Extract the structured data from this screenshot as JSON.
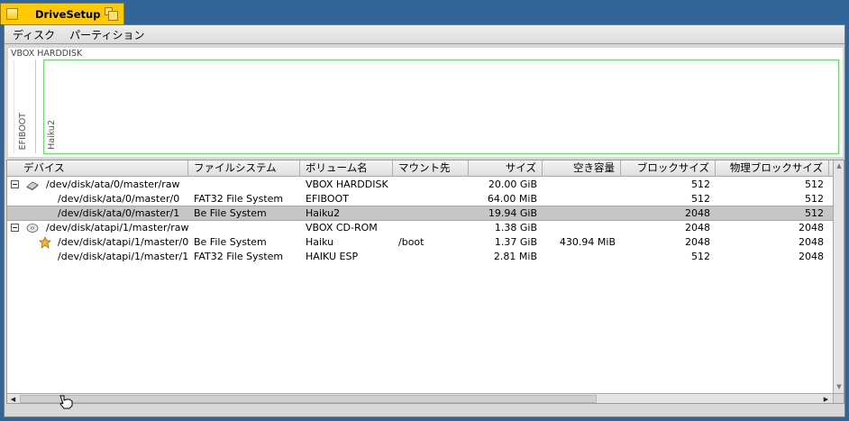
{
  "window": {
    "title": "DriveSetup"
  },
  "menu": {
    "items": [
      "ディスク",
      "パーティション"
    ]
  },
  "disk_map": {
    "disk_label": "VBOX HARDDISK",
    "partitions": [
      "EFIBOOT",
      "Haiku2"
    ]
  },
  "table": {
    "columns": [
      "デバイス",
      "ファイルシステム",
      "ボリューム名",
      "マウント先",
      "サイズ",
      "空き容量",
      "ブロックサイズ",
      "物理ブロックサイズ"
    ],
    "rows": [
      {
        "device": "/dev/disk/ata/0/master/raw",
        "fs": "",
        "volume": "VBOX HARDDISK",
        "mount": "",
        "size": "20.00 GiB",
        "free": "",
        "block": "512",
        "phys": "512",
        "icon": "hard-disk-icon",
        "expander": true
      },
      {
        "device": "/dev/disk/ata/0/master/0",
        "fs": "FAT32 File System",
        "volume": "EFIBOOT",
        "mount": "",
        "size": "64.00 MiB",
        "free": "",
        "block": "512",
        "phys": "512"
      },
      {
        "device": "/dev/disk/ata/0/master/1",
        "fs": "Be File System",
        "volume": "Haiku2",
        "mount": "",
        "size": "19.94 GiB",
        "free": "",
        "block": "2048",
        "phys": "512",
        "selected": true
      },
      {
        "device": "/dev/disk/atapi/1/master/raw",
        "fs": "",
        "volume": "VBOX CD-ROM",
        "mount": "",
        "size": "1.38 GiB",
        "free": "",
        "block": "2048",
        "phys": "2048",
        "icon": "cd-rom-icon",
        "expander": true
      },
      {
        "device": "/dev/disk/atapi/1/master/0",
        "fs": "Be File System",
        "volume": "Haiku",
        "mount": "/boot",
        "size": "1.37 GiB",
        "free": "430.94 MiB",
        "block": "2048",
        "phys": "2048",
        "icon": "haiku-leaf-icon"
      },
      {
        "device": "/dev/disk/atapi/1/master/1",
        "fs": "FAT32 File System",
        "volume": "HAIKU ESP",
        "mount": "",
        "size": "2.81 MiB",
        "free": "",
        "block": "512",
        "phys": "2048"
      }
    ]
  },
  "colors": {
    "desktop": "#336698",
    "tab": "#ffcb00",
    "partition_border": "#5fe35f",
    "selected_row": "#c6c6c6"
  }
}
